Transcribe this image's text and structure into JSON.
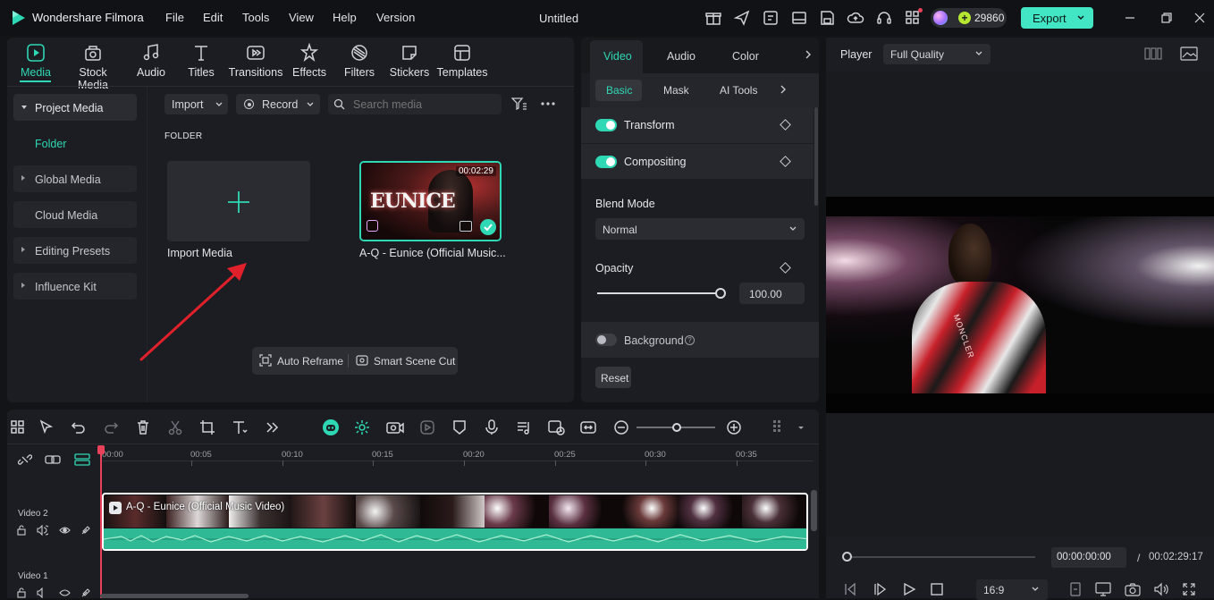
{
  "app": {
    "name": "Wondershare Filmora",
    "document_title": "Untitled",
    "credits": "29860",
    "export_label": "Export"
  },
  "menu": [
    "File",
    "Edit",
    "Tools",
    "View",
    "Help",
    "Version"
  ],
  "tools": [
    {
      "label": "Media",
      "icon": "media-icon"
    },
    {
      "label": "Stock Media",
      "icon": "stock-media-icon"
    },
    {
      "label": "Audio",
      "icon": "audio-icon"
    },
    {
      "label": "Titles",
      "icon": "titles-icon"
    },
    {
      "label": "Transitions",
      "icon": "transitions-icon"
    },
    {
      "label": "Effects",
      "icon": "effects-icon"
    },
    {
      "label": "Filters",
      "icon": "filters-icon"
    },
    {
      "label": "Stickers",
      "icon": "stickers-icon"
    },
    {
      "label": "Templates",
      "icon": "templates-icon"
    }
  ],
  "sidebar": {
    "project_media": "Project Media",
    "folder": "Folder",
    "items": [
      "Global Media",
      "Cloud Media",
      "Editing Presets",
      "Influence Kit"
    ]
  },
  "media_toolbar": {
    "import": "Import",
    "record": "Record",
    "search_placeholder": "Search media"
  },
  "media_area": {
    "folder_heading": "FOLDER",
    "import_tile_label": "Import Media",
    "clip": {
      "name": "A-Q - Eunice (Official Music...",
      "duration": "00:02:29",
      "thumb_text": "EUNICE"
    },
    "actions": [
      "Auto Reframe",
      "Smart Scene Cut"
    ]
  },
  "properties": {
    "tabs": [
      "Video",
      "Audio",
      "Color"
    ],
    "subtabs": [
      "Basic",
      "Mask",
      "AI Tools"
    ],
    "transform": "Transform",
    "compositing": "Compositing",
    "blend_mode_label": "Blend Mode",
    "blend_mode_value": "Normal",
    "opacity_label": "Opacity",
    "opacity_value": "100.00",
    "opacity_fraction": 1.0,
    "background_label": "Background",
    "reset_label": "Reset"
  },
  "player": {
    "label": "Player",
    "quality": "Full Quality",
    "current_time": "00:00:00:00",
    "separator": "/",
    "total_time": "00:02:29:17",
    "aspect": "16:9",
    "overlay_text": "MONCLER"
  },
  "timeline": {
    "ticks": [
      "00:00",
      "00:05",
      "00:10",
      "00:15",
      "00:20",
      "00:25",
      "00:30",
      "00:35"
    ],
    "tracks": [
      "Video 2",
      "Video 1"
    ],
    "clip_title": "A-Q - Eunice (Official Music Video)"
  },
  "colors": {
    "accent": "#2fd8b4",
    "export_bg": "#43e6c4",
    "playhead": "#e8425a",
    "annotation_arrow": "#e0202a",
    "waveform": "#3dc9a3"
  }
}
